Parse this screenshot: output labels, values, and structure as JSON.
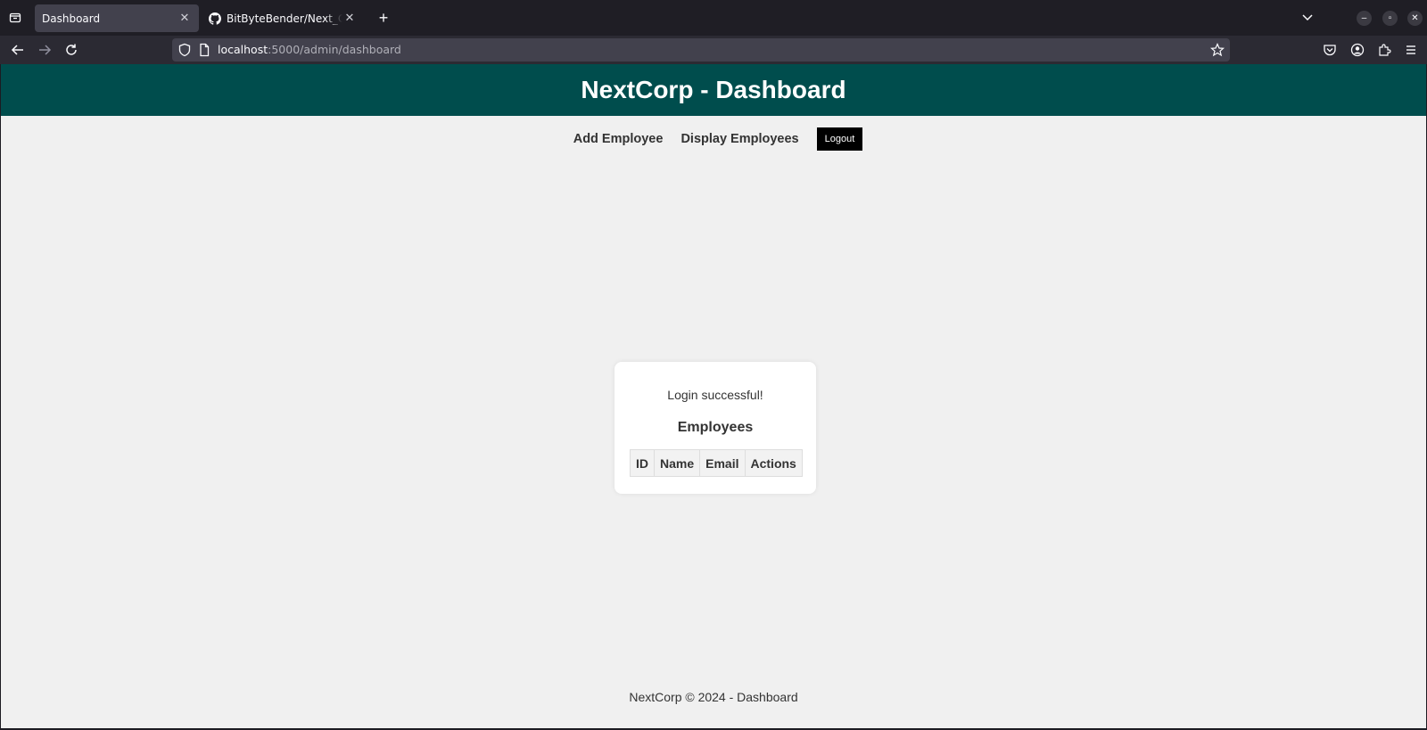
{
  "browser": {
    "tabs": [
      {
        "title": "Dashboard",
        "active": true
      },
      {
        "title": "BitByteBender/Next_Corp",
        "active": false
      }
    ],
    "url": {
      "host": "localhost",
      "rest": ":5000/admin/dashboard"
    }
  },
  "page": {
    "header_title": "NextCorp - Dashboard",
    "nav": {
      "add_employee": "Add Employee",
      "display_employees": "Display Employees",
      "logout": "Logout"
    },
    "card": {
      "flash_message": "Login successful!",
      "heading": "Employees",
      "table_headers": [
        "ID",
        "Name",
        "Email",
        "Actions"
      ]
    },
    "footer": "NextCorp © 2024 - Dashboard"
  },
  "colors": {
    "header_bg": "#004d4d",
    "page_bg": "#f0f0f0",
    "logout_bg": "#000000"
  }
}
